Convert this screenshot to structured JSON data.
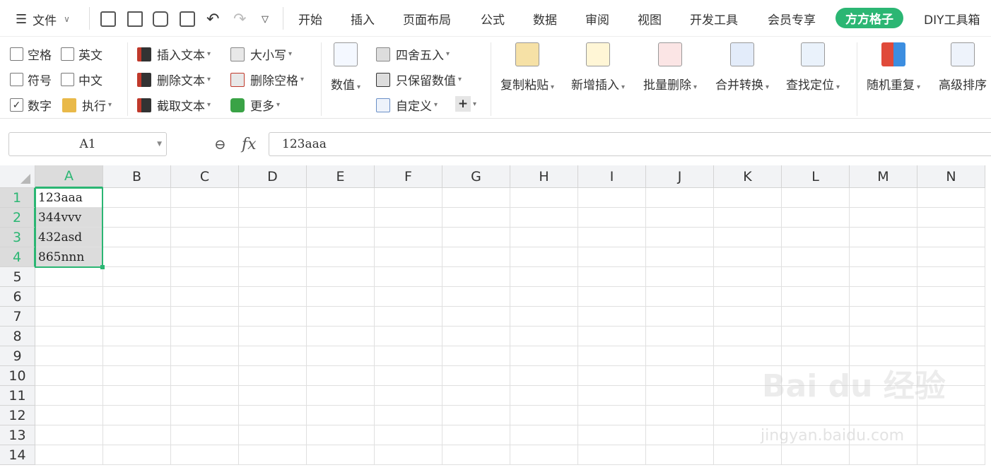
{
  "toolbar": {
    "file_label": "文件",
    "menus": [
      "开始",
      "插入",
      "页面布局",
      "公式",
      "数据",
      "审阅",
      "视图",
      "开发工具",
      "会员专享",
      "方方格子",
      "DIY工具箱"
    ],
    "active_menu": "方方格子"
  },
  "ribbon": {
    "checks": {
      "space": "空格",
      "english": "英文",
      "symbol": "符号",
      "chinese": "中文",
      "number": "数字",
      "execute": "执行"
    },
    "text_ops": {
      "insert": "插入文本",
      "delete": "删除文本",
      "extract": "截取文本"
    },
    "case_ops": {
      "case": "大小写",
      "delspace": "删除空格",
      "more": "更多"
    },
    "value": "数值",
    "num_ops": {
      "round": "四舍五入",
      "keepnum": "只保留数值",
      "custom": "自定义"
    },
    "big": {
      "copy": "复制粘贴",
      "insert": "新增插入",
      "delete": "批量删除",
      "merge": "合并转换",
      "find": "查找定位",
      "random": "随机重复",
      "sort": "高级排序"
    }
  },
  "formula_bar": {
    "name_box": "A1",
    "fx": "fx",
    "formula": "123aaa"
  },
  "sheet": {
    "columns": [
      "A",
      "B",
      "C",
      "D",
      "E",
      "F",
      "G",
      "H",
      "I",
      "J",
      "K",
      "L",
      "M",
      "N"
    ],
    "rows": [
      "1",
      "2",
      "3",
      "4",
      "5",
      "6",
      "7",
      "8",
      "9",
      "10",
      "11",
      "12",
      "13",
      "14"
    ],
    "cells": {
      "A1": "123aaa",
      "A2": "344vvv",
      "A3": "432asd",
      "A4": "865nnn"
    }
  },
  "watermark": {
    "main": "Bai  du 经验",
    "sub": "jingyan.baidu.com"
  },
  "colors": {
    "accent": "#2bb673"
  }
}
